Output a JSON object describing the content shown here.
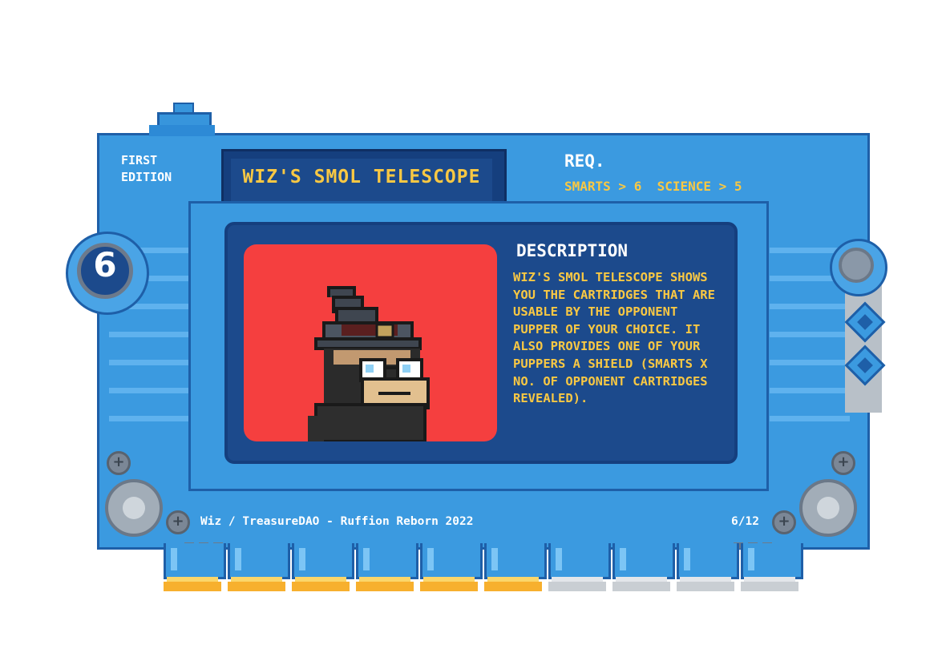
{
  "card": {
    "edition": "FIRST\nEDITION",
    "title": "WIZ'S SMOL TELESCOPE",
    "req_label": "REQ.",
    "requirements": "SMARTS > 6  SCIENCE > 5",
    "cost": "6",
    "description_title": "DESCRIPTION",
    "description": "WIZ'S SMOL TELESCOPE SHOWS\nYOU THE CARTRIDGES THAT ARE\nUSABLE BY THE OPPONENT\nPUPPER OF YOUR CHOICE. IT\nALSO PROVIDES ONE OF YOUR\nPUPPERS A SHIELD (SMARTS X\nNO. OF OPPONENT CARTRIDGES\nREVEALED).",
    "footer": "Wiz / TreasureDAO - Ruffion Reborn 2022",
    "card_number": "6/12",
    "charge": {
      "filled": 6,
      "total": 10
    }
  },
  "colors": {
    "card_blue": "#3b9ae0",
    "border_blue": "#1e5fa8",
    "panel_navy": "#1c4a8c",
    "text_yellow": "#f9c843",
    "portrait_red": "#f53f3f",
    "charge_gold": "#f7b02e",
    "charge_grey": "#c9ced3"
  },
  "icons": {
    "cost_badge": "hex-coin-badge",
    "right_badge": "cross-bolt-icon",
    "portrait": "wizard-monkey-pixel-art"
  }
}
